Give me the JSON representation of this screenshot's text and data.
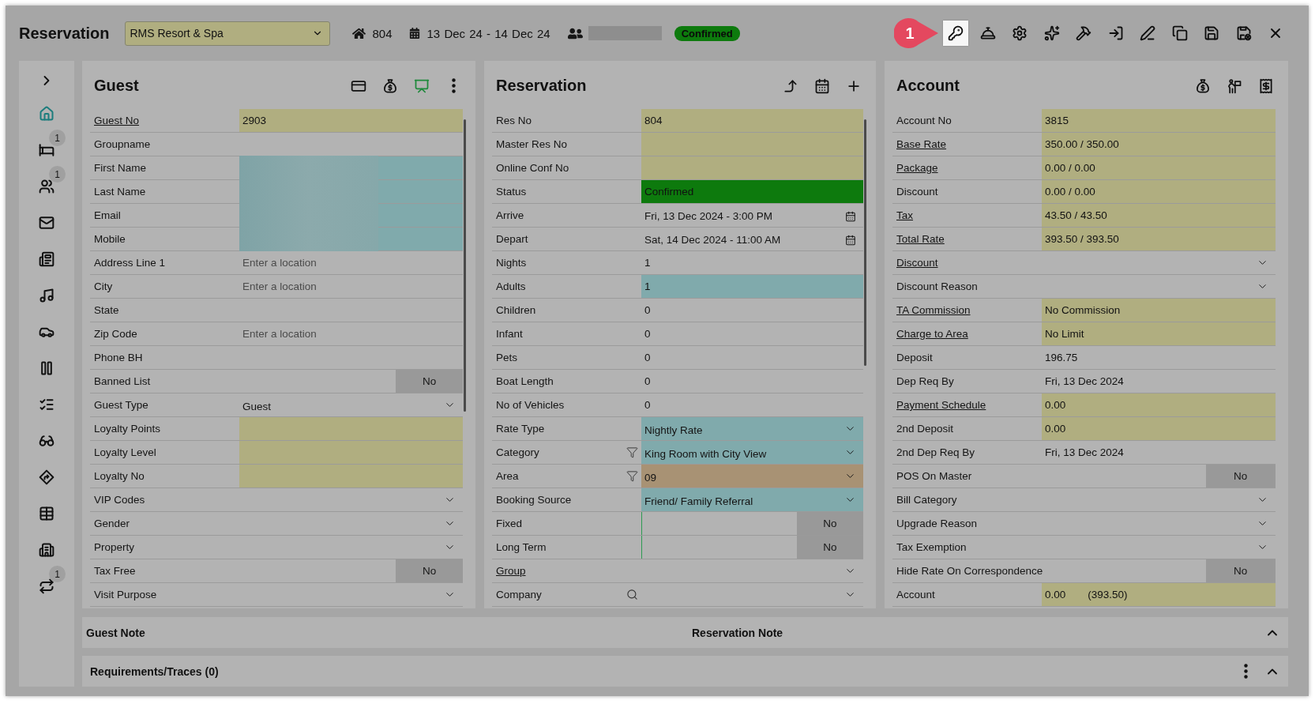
{
  "header": {
    "title": "Reservation",
    "property": "RMS Resort & Spa",
    "room": "804",
    "dates": "13 Dec 24 - 14 Dec 24",
    "guest_redacted": true,
    "status": "Confirmed",
    "callout": "1",
    "toolbar": [
      {
        "highlighted": true
      },
      {
        "highlighted": false
      },
      {
        "highlighted": false
      },
      {
        "highlighted": false
      },
      {
        "highlighted": false
      },
      {
        "highlighted": false
      },
      {
        "highlighted": false
      },
      {
        "highlighted": false
      },
      {
        "highlighted": false
      },
      {
        "highlighted": false
      },
      {
        "highlighted": false
      }
    ]
  },
  "sidebar": {
    "items": [
      {
        "selected": true
      },
      {
        "selected": false,
        "badge": "1"
      },
      {
        "selected": false,
        "badge": "1"
      },
      {
        "selected": false
      },
      {
        "selected": false
      },
      {
        "selected": false
      },
      {
        "selected": false
      },
      {
        "selected": false
      },
      {
        "selected": false
      },
      {
        "selected": false
      },
      {
        "selected": false
      },
      {
        "selected": false
      },
      {
        "selected": false
      },
      {
        "selected": false,
        "badge": "1"
      }
    ]
  },
  "panels": [
    {
      "title": "Guest",
      "actions": [
        {
          "active": false
        },
        {
          "active": false
        },
        {
          "active": true
        },
        {
          "active": false
        }
      ],
      "rows": [
        {
          "label": "Guest No",
          "link": true,
          "kind": "text",
          "value": "2903",
          "color": "#b0ae80"
        },
        {
          "label": "Groupname",
          "link": false,
          "kind": "text"
        },
        {
          "label": "First Name",
          "link": false,
          "kind": "redacted",
          "color": "#80aaac"
        },
        {
          "label": "Last Name",
          "link": false,
          "kind": "redacted",
          "color": "#80aaac"
        },
        {
          "label": "Email",
          "link": false,
          "kind": "redacted",
          "color": "#80aaac"
        },
        {
          "label": "Mobile",
          "link": false,
          "kind": "redacted",
          "color": "#80aaac"
        },
        {
          "label": "Address Line 1",
          "link": false,
          "kind": "input",
          "placeholder": "Enter a location"
        },
        {
          "label": "City",
          "link": false,
          "kind": "input",
          "placeholder": "Enter a location"
        },
        {
          "label": "State",
          "link": false,
          "kind": "text"
        },
        {
          "label": "Zip Code",
          "link": false,
          "kind": "input",
          "placeholder": "Enter a location"
        },
        {
          "label": "Phone BH",
          "link": false,
          "kind": "text"
        },
        {
          "label": "Banned List",
          "link": false,
          "kind": "toggle",
          "value": "No",
          "marked": false
        },
        {
          "label": "Guest Type",
          "link": false,
          "kind": "select",
          "value": "Guest"
        },
        {
          "label": "Loyalty Points",
          "link": false,
          "kind": "text",
          "color": "#b0ae80"
        },
        {
          "label": "Loyalty Level",
          "link": false,
          "kind": "text",
          "color": "#b0ae80"
        },
        {
          "label": "Loyalty No",
          "link": false,
          "kind": "text",
          "color": "#b0ae80"
        },
        {
          "label": "VIP Codes",
          "link": false,
          "kind": "select"
        },
        {
          "label": "Gender",
          "link": false,
          "kind": "select"
        },
        {
          "label": "Property",
          "link": false,
          "kind": "select"
        },
        {
          "label": "Tax Free",
          "link": false,
          "kind": "toggle",
          "value": "No",
          "marked": false
        },
        {
          "label": "Visit Purpose",
          "link": false,
          "kind": "select"
        }
      ]
    },
    {
      "title": "Reservation",
      "actions": [
        {
          "active": false
        },
        {
          "active": false
        },
        {
          "active": false
        }
      ],
      "rows": [
        {
          "label": "Res No",
          "link": false,
          "kind": "text",
          "value": "804",
          "color": "#b0ae80"
        },
        {
          "label": "Master Res No",
          "link": false,
          "kind": "text",
          "color": "#b0ae80"
        },
        {
          "label": "Online Conf No",
          "link": false,
          "kind": "text",
          "color": "#b0ae80"
        },
        {
          "label": "Status",
          "link": false,
          "kind": "text",
          "value": "Confirmed",
          "color": "#0d7a0d"
        },
        {
          "label": "Arrive",
          "link": false,
          "kind": "date",
          "value": "Fri, 13 Dec 2024 - 3:00 PM"
        },
        {
          "label": "Depart",
          "link": false,
          "kind": "date",
          "value": "Sat, 14 Dec 2024 - 11:00 AM"
        },
        {
          "label": "Nights",
          "link": false,
          "kind": "text",
          "value": "1"
        },
        {
          "label": "Adults",
          "link": false,
          "kind": "text",
          "value": "1",
          "color": "#80aaac"
        },
        {
          "label": "Children",
          "link": false,
          "kind": "text",
          "value": "0"
        },
        {
          "label": "Infant",
          "link": false,
          "kind": "text",
          "value": "0"
        },
        {
          "label": "Pets",
          "link": false,
          "kind": "text",
          "value": "0"
        },
        {
          "label": "Boat Length",
          "link": false,
          "kind": "text",
          "value": "0"
        },
        {
          "label": "No of Vehicles",
          "link": false,
          "kind": "text",
          "value": "0"
        },
        {
          "label": "Rate Type",
          "link": false,
          "kind": "select",
          "value": "Nightly Rate",
          "color": "#80aaac"
        },
        {
          "label": "Category",
          "link": false,
          "kind": "select",
          "value": "King Room with City View",
          "color": "#80aaac",
          "filter_icon": true
        },
        {
          "label": "Area",
          "link": false,
          "kind": "select",
          "value": "09",
          "color": "#a89274",
          "filter_icon": true
        },
        {
          "label": "Booking Source",
          "link": false,
          "kind": "select",
          "value": "Friend/ Family Referral",
          "color": "#80aaac"
        },
        {
          "label": "Fixed",
          "link": false,
          "kind": "toggle",
          "value": "No",
          "marked": true
        },
        {
          "label": "Long Term",
          "link": false,
          "kind": "toggle",
          "value": "No",
          "marked": true
        },
        {
          "label": "Group",
          "link": true,
          "kind": "select"
        },
        {
          "label": "Company",
          "link": false,
          "kind": "select",
          "search_icon": true
        }
      ]
    },
    {
      "title": "Account",
      "actions": [
        {
          "active": false
        },
        {
          "active": false
        },
        {
          "active": false
        }
      ],
      "rows": [
        {
          "label": "Account No",
          "link": false,
          "kind": "text",
          "value": "3815",
          "color": "#b0ae80"
        },
        {
          "label": "Base Rate",
          "link": true,
          "kind": "text",
          "value": "350.00 / 350.00",
          "color": "#b0ae80"
        },
        {
          "label": "Package",
          "link": true,
          "kind": "text",
          "value": "0.00 / 0.00",
          "color": "#b0ae80"
        },
        {
          "label": "Discount",
          "link": false,
          "kind": "text",
          "value": "0.00 / 0.00",
          "color": "#b0ae80"
        },
        {
          "label": "Tax",
          "link": true,
          "kind": "text",
          "value": "43.50 / 43.50",
          "color": "#b0ae80"
        },
        {
          "label": "Total Rate",
          "link": true,
          "kind": "text",
          "value": "393.50 / 393.50",
          "color": "#b0ae80"
        },
        {
          "label": "Discount",
          "link": true,
          "kind": "select"
        },
        {
          "label": "Discount Reason",
          "link": false,
          "kind": "select"
        },
        {
          "label": "TA Commission",
          "link": true,
          "kind": "text",
          "value": "No Commission",
          "color": "#b0ae80"
        },
        {
          "label": "Charge to Area",
          "link": true,
          "kind": "text",
          "value": "No Limit",
          "color": "#b0ae80"
        },
        {
          "label": "Deposit",
          "link": false,
          "kind": "text",
          "value": "196.75"
        },
        {
          "label": "Dep Req By",
          "link": false,
          "kind": "text",
          "value": "Fri, 13 Dec 2024"
        },
        {
          "label": "Payment Schedule",
          "link": true,
          "kind": "text",
          "value": "0.00",
          "color": "#b0ae80"
        },
        {
          "label": "2nd Deposit",
          "link": false,
          "kind": "text",
          "value": "0.00",
          "color": "#b0ae80"
        },
        {
          "label": "2nd Dep Req By",
          "link": false,
          "kind": "text",
          "value": "Fri, 13 Dec 2024"
        },
        {
          "label": "POS On Master",
          "link": false,
          "kind": "toggle",
          "value": "No",
          "marked": false
        },
        {
          "label": "Bill Category",
          "link": false,
          "kind": "select"
        },
        {
          "label": "Upgrade Reason",
          "link": false,
          "kind": "select"
        },
        {
          "label": "Tax Exemption",
          "link": false,
          "kind": "select"
        },
        {
          "label": "Hide Rate On Correspondence",
          "link": false,
          "kind": "toggle",
          "value": "No",
          "marked": false
        },
        {
          "label": "Account",
          "link": false,
          "kind": "pair",
          "values": [
            "0.00",
            "(393.50)"
          ],
          "color": "#b0ae80"
        }
      ]
    }
  ],
  "notes_bar": {
    "labels": [
      "Guest Note",
      "Reservation Note"
    ],
    "expanded": false
  },
  "requirements_bar": {
    "title": "Requirements/Traces (0)",
    "expanded": false
  }
}
